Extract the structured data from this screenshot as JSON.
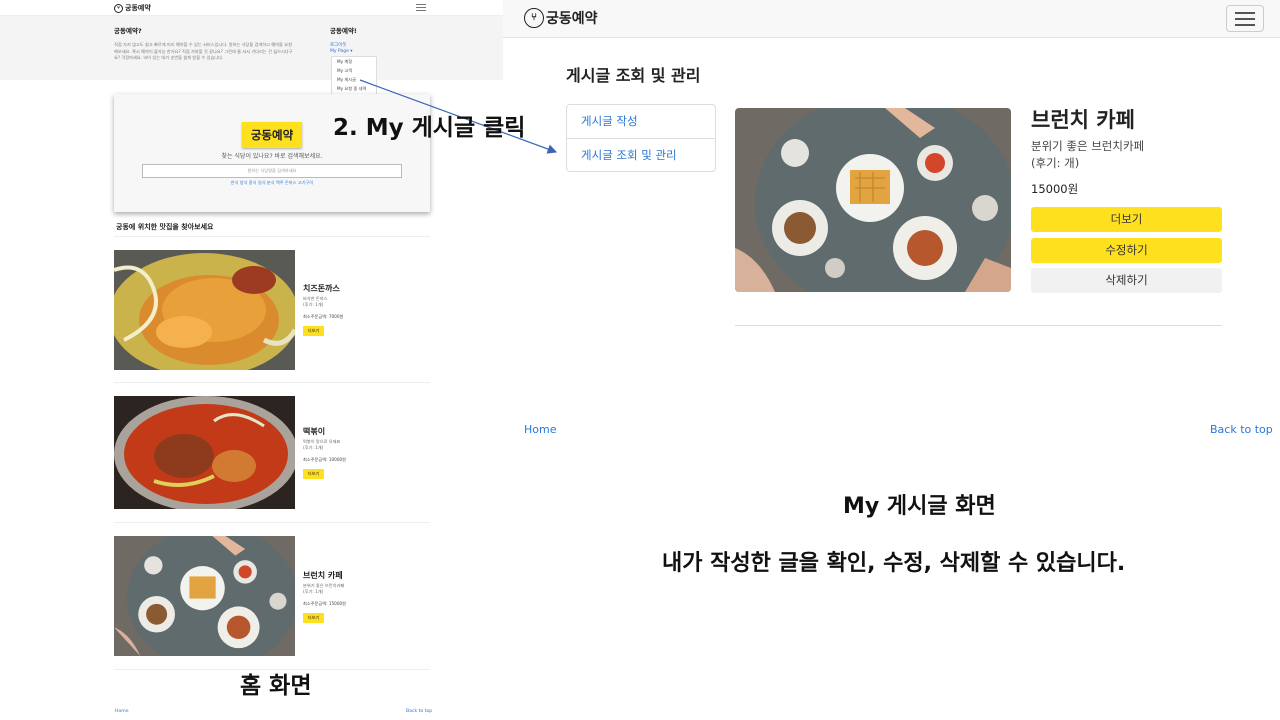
{
  "colors": {
    "accent_yellow": "#ffe01f",
    "link_blue": "#2a78d6",
    "arrow": "#3b64b8"
  },
  "home": {
    "logo": "궁동예약",
    "logo_icon": "restaurant-logo-icon",
    "menu": {
      "about_heading": "궁동예약?",
      "about_text": "직접 가지 않고도 쉽고 빠르게 미리 예약할 수 있는 서비스입니다. 원하는 식당을 검색하고 예약을 요청해보세요. 혹시 예약이 불가능 한가요? 직접 가야할 것 같나요? 그런데 줄 서서 기다리는 건 싫으시다구요? 걱정마세요. 비어 있는 대기 순번을 쉽게 받을 수 있습니다.",
      "links_heading": "궁동예약!",
      "login_link": "로그아웃",
      "mypage_link": "My Page ▾",
      "dropdown_items": [
        "My 계정",
        "My 고객",
        "My 게시글",
        "My 요청 중 내역"
      ]
    },
    "search": {
      "brand_button": "궁동예약",
      "prompt": "찾는 식당이 있나요? 바로 검색해보세요.",
      "placeholder": "원하는 식당명을 검색하세요",
      "categories": "한식 양식 중식 일식 분식 맥주 돈까스 고기구이"
    },
    "section_title": "궁동에 위치한 맛집을 찾아보세요",
    "cards": [
      {
        "title": "치즈돈까스",
        "desc": "바삭한 돈까스",
        "review": "(후기: 1개)",
        "price": "최소주문금액: 7000원",
        "button": "더보기"
      },
      {
        "title": "떡볶이",
        "desc": "떡볶이 맛으로 유재표",
        "review": "(후기: 1개)",
        "price": "최소주문금액: 10000원",
        "button": "더보기"
      },
      {
        "title": "브런치 카페",
        "desc": "분위기 좋은 브런치카페",
        "review": "(후기: 1개)",
        "price": "최소주문금액: 15000원",
        "button": "더보기"
      }
    ],
    "footer": {
      "home": "Home",
      "top": "Back to top"
    }
  },
  "mine": {
    "logo": "궁동예약",
    "logo_icon": "restaurant-logo-icon",
    "page_title": "게시글 조회 및 관리",
    "side_menu": [
      "게시글 작성",
      "게시글 조회 및 관리"
    ],
    "post": {
      "title": "브런치 카페",
      "desc": "분위기 좋은 브런치카페",
      "review": "(후기: 개)",
      "price": "15000원",
      "more_button": "더보기",
      "edit_button": "수정하기",
      "delete_button": "삭제하기"
    },
    "footer": {
      "home": "Home",
      "top": "Back to top"
    }
  },
  "annotations": {
    "step": "2. My 게시글 클릭",
    "home_caption": "홈 화면",
    "mine_caption": "My 게시글 화면",
    "mine_desc": "내가 작성한 글을 확인, 수정, 삭제할 수 있습니다."
  }
}
